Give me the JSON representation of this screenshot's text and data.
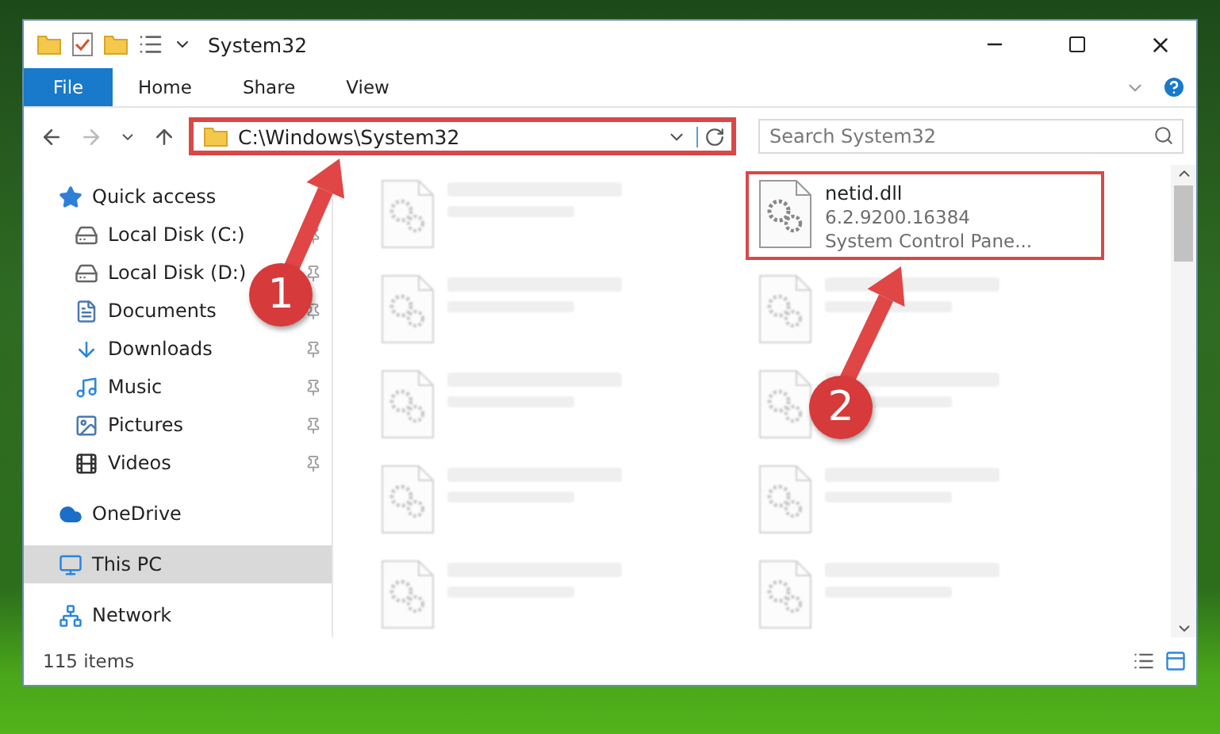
{
  "window": {
    "title": "System32"
  },
  "ribbon_tabs": [
    {
      "label": "File",
      "kind": "menu"
    },
    {
      "label": "Home",
      "kind": "tab"
    },
    {
      "label": "Share",
      "kind": "tab"
    },
    {
      "label": "View",
      "kind": "tab"
    }
  ],
  "address": {
    "path": "C:\\Windows\\System32",
    "highlighted": true
  },
  "search": {
    "placeholder": "Search System32"
  },
  "nav": [
    {
      "label": "Quick access",
      "kind": "star",
      "pinned": false,
      "selected": false,
      "children": [
        {
          "label": "Local Disk (C:)",
          "kind": "drive",
          "pinned": true,
          "selected": false
        },
        {
          "label": "Local Disk (D:)",
          "kind": "drive",
          "pinned": true,
          "selected": false
        },
        {
          "label": "Documents",
          "kind": "document",
          "pinned": true,
          "selected": false
        },
        {
          "label": "Downloads",
          "kind": "download",
          "pinned": true,
          "selected": false
        },
        {
          "label": "Music",
          "kind": "music",
          "pinned": true,
          "selected": false
        },
        {
          "label": "Pictures",
          "kind": "picture",
          "pinned": true,
          "selected": false
        },
        {
          "label": "Videos",
          "kind": "video",
          "pinned": true,
          "selected": false
        }
      ]
    },
    {
      "label": "OneDrive",
      "kind": "cloud",
      "pinned": false,
      "selected": false
    },
    {
      "label": "This PC",
      "kind": "computer",
      "pinned": false,
      "selected": true
    },
    {
      "label": "Network",
      "kind": "network",
      "pinned": false,
      "selected": false
    }
  ],
  "files": [
    {
      "blurred": true,
      "highlighted": false
    },
    {
      "name": "netid.dll",
      "details": [
        "6.2.9200.16384",
        "System Control Pane..."
      ],
      "blurred": false,
      "highlighted": true
    },
    {
      "blurred": true,
      "highlighted": false
    },
    {
      "blurred": true,
      "highlighted": false
    },
    {
      "blurred": true,
      "highlighted": false
    },
    {
      "blurred": true,
      "highlighted": false
    },
    {
      "blurred": true,
      "highlighted": false
    },
    {
      "blurred": true,
      "highlighted": false
    },
    {
      "blurred": true,
      "highlighted": false
    },
    {
      "blurred": true,
      "highlighted": false
    }
  ],
  "status_bar": {
    "count": "115 items"
  },
  "annotations": [
    {
      "number": "1"
    },
    {
      "number": "2"
    }
  ]
}
